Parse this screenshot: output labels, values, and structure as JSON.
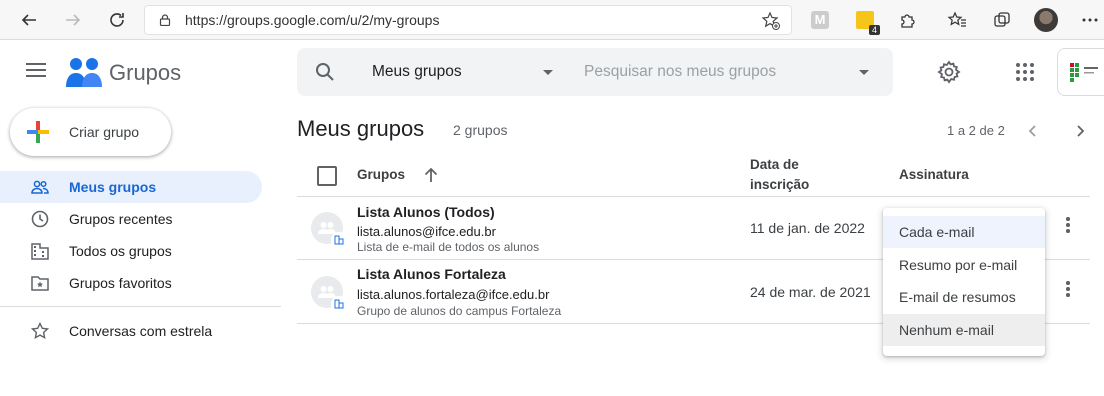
{
  "browser": {
    "url": "https://groups.google.com/u/2/my-groups",
    "ext_badge": "4"
  },
  "app": {
    "title": "Grupos"
  },
  "search": {
    "scope": "Meus grupos",
    "placeholder": "Pesquisar nos meus grupos"
  },
  "sidebar": {
    "create_label": "Criar grupo",
    "items": [
      {
        "label": "Meus grupos",
        "icon": "people-icon",
        "active": true
      },
      {
        "label": "Grupos recentes",
        "icon": "clock-icon"
      },
      {
        "label": "Todos os grupos",
        "icon": "building-icon"
      },
      {
        "label": "Grupos favoritos",
        "icon": "star-folder-icon"
      },
      {
        "label": "Conversas com estrela",
        "icon": "star-icon"
      }
    ]
  },
  "main": {
    "title": "Meus grupos",
    "count": "2 grupos",
    "pager": "1 a 2 de 2",
    "columns": {
      "groups": "Grupos",
      "date_line1": "Data de",
      "date_line2": "inscrição",
      "subscription": "Assinatura"
    },
    "rows": [
      {
        "name": "Lista Alunos (Todos)",
        "email": "lista.alunos@ifce.edu.br",
        "description": "Lista de e-mail de todos os alunos",
        "date": "11 de jan. de 2022"
      },
      {
        "name": "Lista Alunos Fortaleza",
        "email": "lista.alunos.fortaleza@ifce.edu.br",
        "description": "Grupo de alunos do campus Fortaleza",
        "date": "24 de mar. de 2021"
      }
    ]
  },
  "menu": {
    "items": [
      "Cada e-mail",
      "Resumo por e-mail",
      "E-mail de resumos",
      "Nenhum e-mail"
    ]
  },
  "colors": {
    "accent": "#1967d2",
    "active_bg": "#e8f0fe"
  }
}
